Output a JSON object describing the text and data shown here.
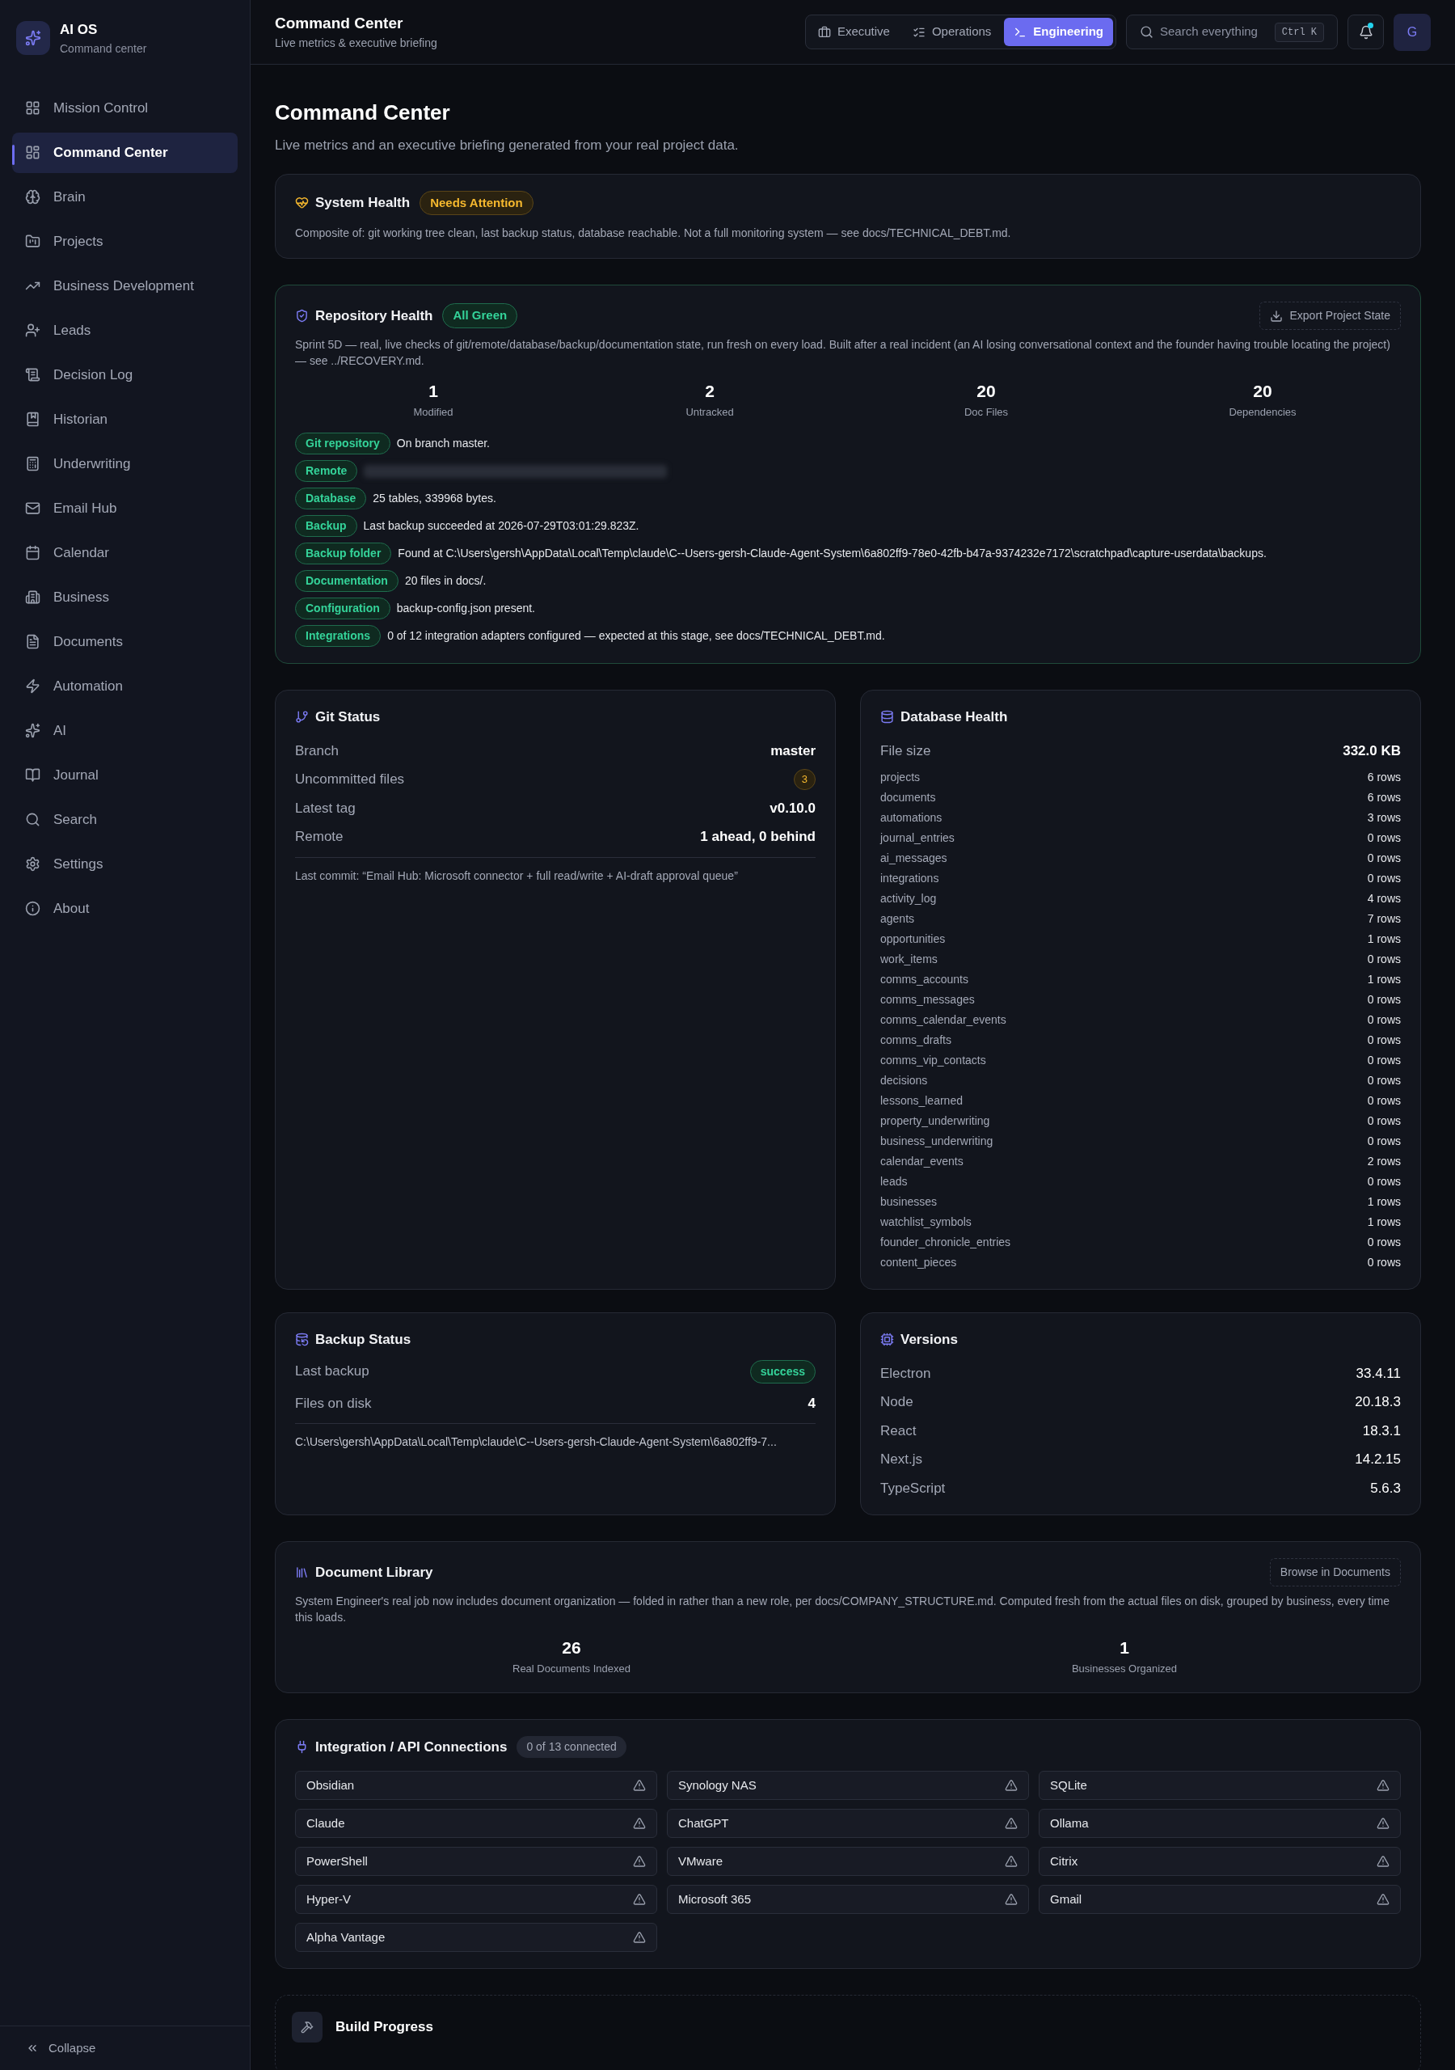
{
  "sidebar": {
    "app_name": "AI OS",
    "app_subtitle": "Command center",
    "items": [
      {
        "label": "Mission Control",
        "selected": false
      },
      {
        "label": "Command Center",
        "selected": true
      },
      {
        "label": "Brain",
        "selected": false
      },
      {
        "label": "Projects",
        "selected": false
      },
      {
        "label": "Business Development",
        "selected": false
      },
      {
        "label": "Leads",
        "selected": false
      },
      {
        "label": "Decision Log",
        "selected": false
      },
      {
        "label": "Historian",
        "selected": false
      },
      {
        "label": "Underwriting",
        "selected": false
      },
      {
        "label": "Email Hub",
        "selected": false
      },
      {
        "label": "Calendar",
        "selected": false
      },
      {
        "label": "Business",
        "selected": false
      },
      {
        "label": "Documents",
        "selected": false
      },
      {
        "label": "Automation",
        "selected": false
      },
      {
        "label": "AI",
        "selected": false
      },
      {
        "label": "Journal",
        "selected": false
      },
      {
        "label": "Search",
        "selected": false
      },
      {
        "label": "Settings",
        "selected": false
      },
      {
        "label": "About",
        "selected": false
      }
    ],
    "collapse_label": "Collapse"
  },
  "header": {
    "title": "Command Center",
    "subtitle": "Live metrics & executive briefing",
    "view_tabs": [
      {
        "label": "Executive",
        "selected": false
      },
      {
        "label": "Operations",
        "selected": false
      },
      {
        "label": "Engineering",
        "selected": true
      }
    ],
    "search": {
      "placeholder": "Search everything",
      "shortcut": "Ctrl K"
    },
    "avatar": "G"
  },
  "page": {
    "title": "Command Center",
    "subtitle": "Live metrics and an executive briefing generated from your real project data."
  },
  "system_health": {
    "title": "System Health",
    "badge": "Needs Attention",
    "description": "Composite of: git working tree clean, last backup status, database reachable. Not a full monitoring system — see docs/TECHNICAL_DEBT.md."
  },
  "repository_health": {
    "title": "Repository Health",
    "badge": "All Green",
    "export_button": "Export Project State",
    "description": "Sprint 5D — real, live checks of git/remote/database/backup/documentation state, run fresh on every load. Built after a real incident (an AI losing conversational context and the founder having trouble locating the project) — see ../RECOVERY.md.",
    "stats": [
      {
        "value": "1",
        "label": "Modified"
      },
      {
        "value": "2",
        "label": "Untracked"
      },
      {
        "value": "20",
        "label": "Doc Files"
      },
      {
        "value": "20",
        "label": "Dependencies"
      }
    ],
    "checks": [
      {
        "tag": "Git repository",
        "text": "On branch master.",
        "redacted": false
      },
      {
        "tag": "Remote",
        "redacted": true
      },
      {
        "tag": "Database",
        "text": "25 tables, 339968 bytes.",
        "redacted": false
      },
      {
        "tag": "Backup",
        "text": "Last backup succeeded at 2026-07-29T03:01:29.823Z.",
        "redacted": false
      },
      {
        "tag": "Backup folder",
        "text": "Found at C:\\Users\\gersh\\AppData\\Local\\Temp\\claude\\C--Users-gersh-Claude-Agent-System\\6a802ff9-78e0-42fb-b47a-9374232e7172\\scratchpad\\capture-userdata\\backups.",
        "redacted": false
      },
      {
        "tag": "Documentation",
        "text": "20 files in docs/.",
        "redacted": false
      },
      {
        "tag": "Configuration",
        "text": "backup-config.json present.",
        "redacted": false
      },
      {
        "tag": "Integrations",
        "text": "0 of 12 integration adapters configured — expected at this stage, see docs/TECHNICAL_DEBT.md.",
        "redacted": false
      }
    ]
  },
  "git_status": {
    "title": "Git Status",
    "rows": [
      {
        "label": "Branch",
        "value": "master",
        "kind": "text"
      },
      {
        "label": "Uncommitted files",
        "value": "3",
        "kind": "badge"
      },
      {
        "label": "Latest tag",
        "value": "v0.10.0",
        "kind": "text"
      },
      {
        "label": "Remote",
        "value": "1 ahead, 0 behind",
        "kind": "text"
      }
    ],
    "last_commit": "Last commit: “Email Hub: Microsoft connector + full read/write + AI-draft approval queue”"
  },
  "database_health": {
    "title": "Database Health",
    "file_size_label": "File size",
    "file_size": "332.0 KB",
    "tables": [
      {
        "name": "projects",
        "rows": "6 rows"
      },
      {
        "name": "documents",
        "rows": "6 rows"
      },
      {
        "name": "automations",
        "rows": "3 rows"
      },
      {
        "name": "journal_entries",
        "rows": "0 rows"
      },
      {
        "name": "ai_messages",
        "rows": "0 rows"
      },
      {
        "name": "integrations",
        "rows": "0 rows"
      },
      {
        "name": "activity_log",
        "rows": "4 rows"
      },
      {
        "name": "agents",
        "rows": "7 rows"
      },
      {
        "name": "opportunities",
        "rows": "1 rows"
      },
      {
        "name": "work_items",
        "rows": "0 rows"
      },
      {
        "name": "comms_accounts",
        "rows": "1 rows"
      },
      {
        "name": "comms_messages",
        "rows": "0 rows"
      },
      {
        "name": "comms_calendar_events",
        "rows": "0 rows"
      },
      {
        "name": "comms_drafts",
        "rows": "0 rows"
      },
      {
        "name": "comms_vip_contacts",
        "rows": "0 rows"
      },
      {
        "name": "decisions",
        "rows": "0 rows"
      },
      {
        "name": "lessons_learned",
        "rows": "0 rows"
      },
      {
        "name": "property_underwriting",
        "rows": "0 rows"
      },
      {
        "name": "business_underwriting",
        "rows": "0 rows"
      },
      {
        "name": "calendar_events",
        "rows": "2 rows"
      },
      {
        "name": "leads",
        "rows": "0 rows"
      },
      {
        "name": "businesses",
        "rows": "1 rows"
      },
      {
        "name": "watchlist_symbols",
        "rows": "1 rows"
      },
      {
        "name": "founder_chronicle_entries",
        "rows": "0 rows"
      },
      {
        "name": "content_pieces",
        "rows": "0 rows"
      }
    ]
  },
  "backup_status": {
    "title": "Backup Status",
    "rows": [
      {
        "label": "Last backup",
        "value": "success",
        "kind": "badge"
      },
      {
        "label": "Files on disk",
        "value": "4",
        "kind": "text"
      }
    ],
    "path": "C:\\Users\\gersh\\AppData\\Local\\Temp\\claude\\C--Users-gersh-Claude-Agent-System\\6a802ff9-7..."
  },
  "versions": {
    "title": "Versions",
    "rows": [
      {
        "label": "Electron",
        "value": "33.4.11"
      },
      {
        "label": "Node",
        "value": "20.18.3"
      },
      {
        "label": "React",
        "value": "18.3.1"
      },
      {
        "label": "Next.js",
        "value": "14.2.15"
      },
      {
        "label": "TypeScript",
        "value": "5.6.3"
      }
    ]
  },
  "document_library": {
    "title": "Document Library",
    "button": "Browse in Documents",
    "description": "System Engineer's real job now includes document organization — folded in rather than a new role, per docs/COMPANY_STRUCTURE.md. Computed fresh from the actual files on disk, grouped by business, every time this loads.",
    "stats": [
      {
        "value": "26",
        "label": "Real Documents Indexed"
      },
      {
        "value": "1",
        "label": "Businesses Organized"
      }
    ]
  },
  "integrations": {
    "title": "Integration / API Connections",
    "count_badge": "0 of 13 connected",
    "items": [
      {
        "name": "Obsidian",
        "connected": false
      },
      {
        "name": "Synology NAS",
        "connected": false
      },
      {
        "name": "SQLite",
        "connected": false
      },
      {
        "name": "Claude",
        "connected": false
      },
      {
        "name": "ChatGPT",
        "connected": false
      },
      {
        "name": "Ollama",
        "connected": false
      },
      {
        "name": "PowerShell",
        "connected": false
      },
      {
        "name": "VMware",
        "connected": false
      },
      {
        "name": "Citrix",
        "connected": false
      },
      {
        "name": "Hyper-V",
        "connected": false
      },
      {
        "name": "Microsoft 365",
        "connected": false
      },
      {
        "name": "Gmail",
        "connected": false
      },
      {
        "name": "Alpha Vantage",
        "connected": false
      }
    ]
  },
  "build_progress": {
    "title": "Build Progress"
  }
}
